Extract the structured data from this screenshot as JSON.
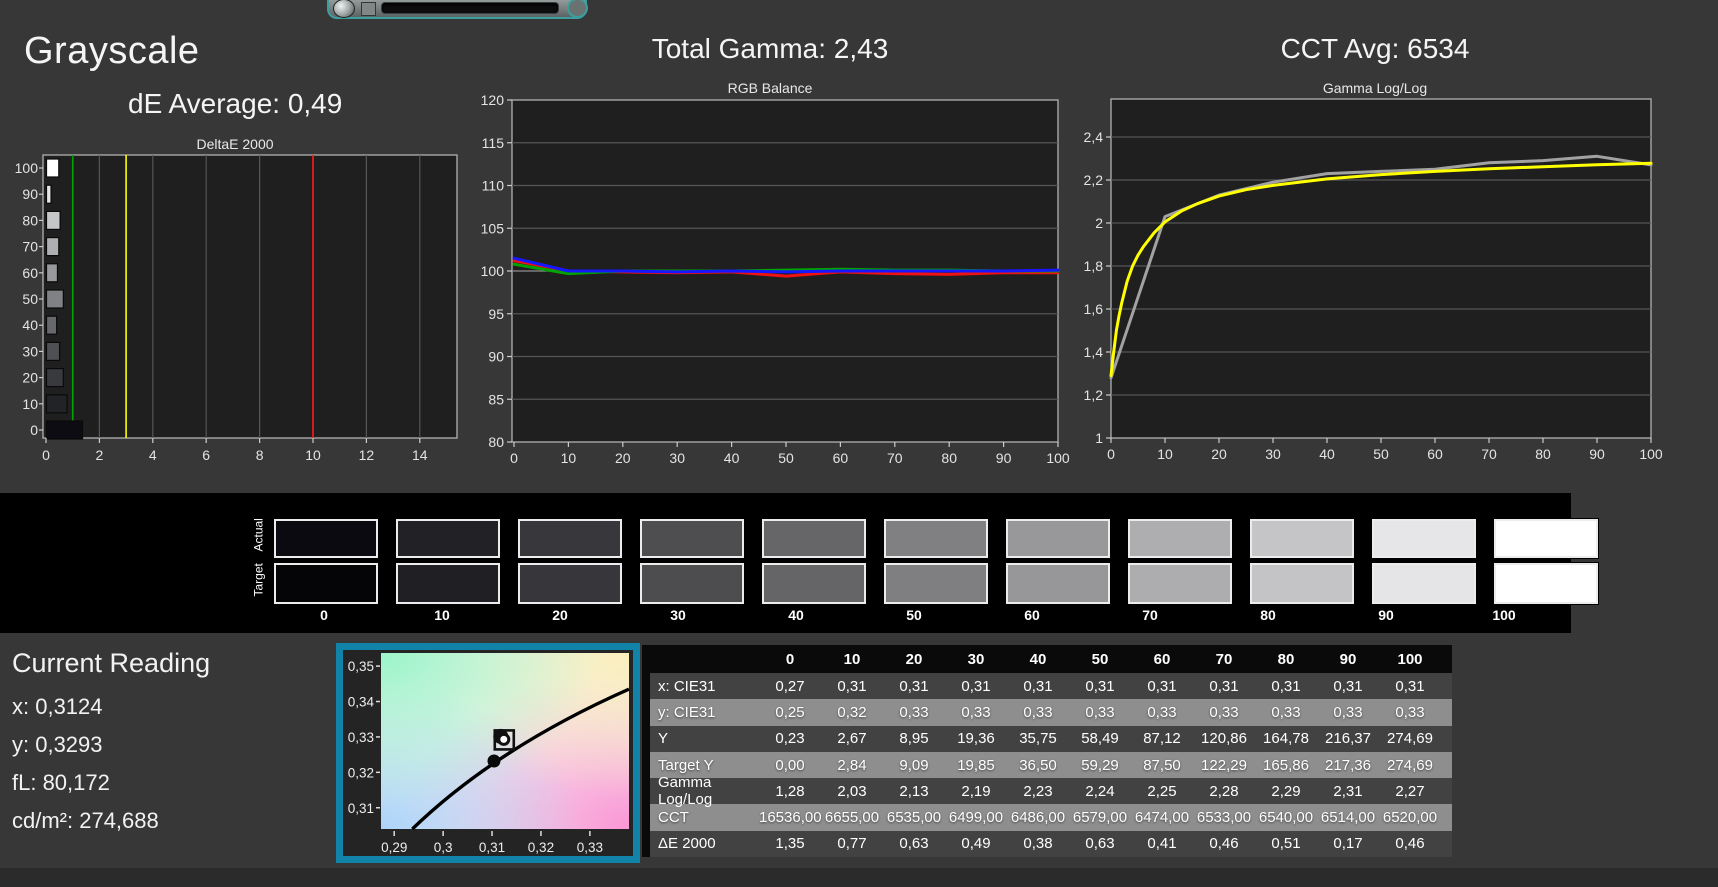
{
  "titles": {
    "grayscale": "Grayscale",
    "de_average": "dE Average: 0,49",
    "total_gamma": "Total Gamma: 2,43",
    "cct_avg": "CCT Avg: 6534"
  },
  "chart_data": [
    {
      "id": "deltae",
      "type": "bar",
      "title": "DeltaE 2000",
      "orientation": "horizontal",
      "categories": [
        0,
        10,
        20,
        30,
        40,
        50,
        60,
        70,
        80,
        90,
        100
      ],
      "values": [
        1.35,
        0.77,
        0.63,
        0.49,
        0.38,
        0.63,
        0.41,
        0.46,
        0.51,
        0.17,
        0.46
      ],
      "bar_colors": [
        "#0c0c12",
        "#222327",
        "#393a3e",
        "#4f5053",
        "#67686b",
        "#808184",
        "#98999c",
        "#aeafb2",
        "#c5c6c8",
        "#e6e6e8",
        "#ffffff"
      ],
      "xlim": [
        0,
        15.2
      ],
      "xticks": [
        0,
        2,
        4,
        6,
        8,
        10,
        12,
        14
      ],
      "ref_lines": [
        {
          "x": 1,
          "color": "#00a400"
        },
        {
          "x": 3,
          "color": "#ffff00"
        },
        {
          "x": 10,
          "color": "#ff1a1a"
        }
      ],
      "note": "levels listed bottom-to-top order 0..100, drawn 100 at top"
    },
    {
      "id": "rgb_balance",
      "type": "line",
      "title": "RGB Balance",
      "x": [
        0,
        10,
        20,
        30,
        40,
        50,
        60,
        70,
        80,
        90,
        100
      ],
      "ylim": [
        80,
        120
      ],
      "yticks": [
        80,
        85,
        90,
        95,
        100,
        105,
        110,
        115,
        120
      ],
      "highlight_gridline": 100,
      "xticks": [
        0,
        10,
        20,
        30,
        40,
        50,
        60,
        70,
        80,
        90,
        100
      ],
      "series": [
        {
          "name": "red",
          "color": "#ee1212",
          "values": [
            101.2,
            100.0,
            99.9,
            99.8,
            99.9,
            99.4,
            99.9,
            99.7,
            99.6,
            99.8,
            99.8
          ]
        },
        {
          "name": "green",
          "color": "#00a400",
          "values": [
            100.8,
            99.7,
            100.0,
            100.0,
            100.0,
            100.1,
            100.2,
            100.1,
            100.1,
            100.0,
            100.0
          ]
        },
        {
          "name": "blue",
          "color": "#1616ff",
          "values": [
            101.5,
            100.0,
            100.0,
            99.9,
            100.0,
            99.9,
            100.0,
            100.0,
            100.0,
            100.0,
            100.1
          ]
        }
      ]
    },
    {
      "id": "gamma_loglog",
      "type": "line",
      "title": "Gamma Log/Log",
      "ylim": [
        1,
        2.577
      ],
      "yticks": [
        1,
        1.2,
        1.4,
        1.6,
        1.8,
        2,
        2.2,
        2.4
      ],
      "ytick_labels": [
        "1",
        "1,2",
        "1,4",
        "1,6",
        "1,8",
        "2",
        "2,2",
        "2,4"
      ],
      "xticks": [
        0,
        10,
        20,
        30,
        40,
        50,
        60,
        70,
        80,
        90,
        100
      ],
      "series": [
        {
          "name": "measured",
          "color": "#a2a2a2",
          "x": [
            0,
            10,
            20,
            30,
            40,
            50,
            60,
            70,
            80,
            90,
            100
          ],
          "values": [
            1.28,
            2.03,
            2.13,
            2.19,
            2.23,
            2.24,
            2.25,
            2.28,
            2.29,
            2.31,
            2.27
          ]
        },
        {
          "name": "target",
          "color": "#ffff00",
          "x": [
            0,
            0.5,
            1,
            1.5,
            2,
            3,
            4,
            5,
            6,
            8,
            10,
            13,
            16,
            20,
            25,
            30,
            40,
            50,
            60,
            70,
            80,
            90,
            100
          ],
          "values": [
            1.29,
            1.4,
            1.5,
            1.57,
            1.63,
            1.73,
            1.8,
            1.85,
            1.89,
            1.955,
            2.005,
            2.055,
            2.09,
            2.125,
            2.155,
            2.175,
            2.205,
            2.225,
            2.24,
            2.252,
            2.262,
            2.271,
            2.278
          ]
        }
      ]
    },
    {
      "id": "cie_xy",
      "type": "scatter",
      "title": "",
      "xlim": [
        0.2873,
        0.338
      ],
      "ylim": [
        0.304,
        0.3537
      ],
      "xticks": [
        0.29,
        0.3,
        0.31,
        0.32,
        0.33
      ],
      "xtick_labels": [
        "0,29",
        "0,3",
        "0,31",
        "0,32",
        "0,33"
      ],
      "yticks": [
        0.35,
        0.34,
        0.33,
        0.32,
        0.31
      ],
      "ytick_labels": [
        "0,35",
        "0,34",
        "0,33",
        "0,32",
        "0,31"
      ],
      "points": [
        {
          "name": "current-reading-marker",
          "x": 0.3124,
          "y": 0.3293
        },
        {
          "name": "reference-dot",
          "x": 0.3104,
          "y": 0.3232
        }
      ],
      "locus_line": "daylight locus, lower-left to upper-right"
    }
  ],
  "swatches": {
    "row_labels": [
      "Actual",
      "Target"
    ],
    "levels": [
      "0",
      "10",
      "20",
      "30",
      "40",
      "50",
      "60",
      "70",
      "80",
      "90",
      "100"
    ],
    "actual_colors": [
      "#0a0a10",
      "#222226",
      "#38383c",
      "#4e4e51",
      "#666669",
      "#808082",
      "#98989b",
      "#aeaeb1",
      "#c5c5c7",
      "#e6e6e8",
      "#ffffff"
    ],
    "target_colors": [
      "#050508",
      "#202024",
      "#37373b",
      "#4d4d50",
      "#656568",
      "#7f7f81",
      "#97979a",
      "#adadb0",
      "#c4c4c6",
      "#e5e5e7",
      "#ffffff"
    ]
  },
  "current_reading": {
    "title": "Current Reading",
    "lines": [
      "x: 0,3124",
      "y: 0,3293",
      "fL: 80,172",
      "cd/m²: 274,688"
    ]
  },
  "table": {
    "columns": [
      "0",
      "10",
      "20",
      "30",
      "40",
      "50",
      "60",
      "70",
      "80",
      "90",
      "100"
    ],
    "rows": [
      {
        "label": "x: CIE31",
        "values": [
          "0,27",
          "0,31",
          "0,31",
          "0,31",
          "0,31",
          "0,31",
          "0,31",
          "0,31",
          "0,31",
          "0,31",
          "0,31"
        ]
      },
      {
        "label": "y: CIE31",
        "values": [
          "0,25",
          "0,32",
          "0,33",
          "0,33",
          "0,33",
          "0,33",
          "0,33",
          "0,33",
          "0,33",
          "0,33",
          "0,33"
        ]
      },
      {
        "label": "Y",
        "values": [
          "0,23",
          "2,67",
          "8,95",
          "19,36",
          "35,75",
          "58,49",
          "87,12",
          "120,86",
          "164,78",
          "216,37",
          "274,69"
        ]
      },
      {
        "label": "Target Y",
        "values": [
          "0,00",
          "2,84",
          "9,09",
          "19,85",
          "36,50",
          "59,29",
          "87,50",
          "122,29",
          "165,86",
          "217,36",
          "274,69"
        ]
      },
      {
        "label": "Gamma Log/Log",
        "values": [
          "1,28",
          "2,03",
          "2,13",
          "2,19",
          "2,23",
          "2,24",
          "2,25",
          "2,28",
          "2,29",
          "2,31",
          "2,27"
        ]
      },
      {
        "label": "CCT",
        "values": [
          "16536,00",
          "6655,00",
          "6535,00",
          "6499,00",
          "6486,00",
          "6579,00",
          "6474,00",
          "6533,00",
          "6540,00",
          "6514,00",
          "6520,00"
        ]
      },
      {
        "label": "ΔE 2000",
        "values": [
          "1,35",
          "0,77",
          "0,63",
          "0,49",
          "0,38",
          "0,63",
          "0,41",
          "0,46",
          "0,51",
          "0,17",
          "0,46"
        ]
      }
    ]
  },
  "colors": {
    "page_bg": "#373737",
    "plot_bg": "#1f1f1f",
    "grid": "#565656",
    "grid_bright": "#8f8f8f",
    "plot_border": "#a8a8a8",
    "band_bg": "#000000",
    "teal_border": "#1283a8",
    "table_header_bg": "#0a0a0a",
    "table_dark_row": "#424242",
    "table_light_row": "#8e8e8e"
  }
}
